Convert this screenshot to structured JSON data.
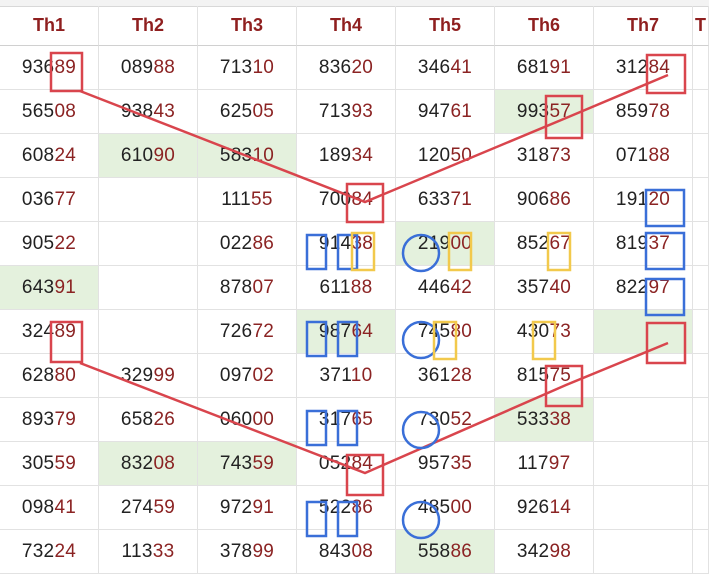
{
  "table": {
    "headers": [
      "Th1",
      "Th2",
      "Th3",
      "Th4",
      "Th5",
      "Th6",
      "Th7",
      "T"
    ],
    "rows": [
      [
        "93689",
        "08988",
        "71310",
        "83620",
        "34641",
        "68191",
        "31284",
        ""
      ],
      [
        "56508",
        "93843",
        "62505",
        "71393",
        "94761",
        "99357",
        "85978",
        ""
      ],
      [
        "60824",
        "61090",
        "58310",
        "18934",
        "12050",
        "31873",
        "07188",
        ""
      ],
      [
        "03677",
        "",
        "11155",
        "70084",
        "63371",
        "90686",
        "19120",
        ""
      ],
      [
        "90522",
        "",
        "02286",
        "91438",
        "21900",
        "85267",
        "81937",
        ""
      ],
      [
        "64391",
        "",
        "87807",
        "61188",
        "44642",
        "35740",
        "82297",
        ""
      ],
      [
        "32489",
        "",
        "72672",
        "98764",
        "74580",
        "43073",
        "",
        ""
      ],
      [
        "62880",
        "32999",
        "09702",
        "37110",
        "36128",
        "81575",
        "",
        ""
      ],
      [
        "89379",
        "65826",
        "06000",
        "31765",
        "73052",
        "53338",
        "",
        ""
      ],
      [
        "30559",
        "83208",
        "74359",
        "05284",
        "95735",
        "11797",
        "",
        ""
      ],
      [
        "09841",
        "27459",
        "97291",
        "52286",
        "48500",
        "92614",
        "",
        ""
      ],
      [
        "73224",
        "11333",
        "37899",
        "84308",
        "55886",
        "34298",
        "",
        ""
      ]
    ]
  },
  "colors": {
    "red_mark": "#d9454d",
    "blue_mark": "#3a6fd8",
    "yellow_mark": "#f2c94c",
    "highlight": "#e4f1dd"
  }
}
